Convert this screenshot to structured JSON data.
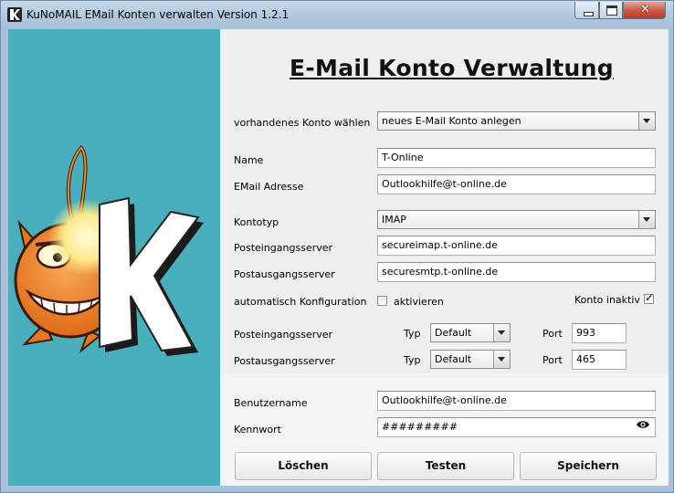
{
  "window": {
    "title": "KuNoMAIL EMail Konten verwalten Version 1.2.1"
  },
  "heading": "E-Mail Konto Verwaltung",
  "account_select": {
    "label": "vorhandenes Konto wählen",
    "value": "neues E-Mail Konto anlegen"
  },
  "name": {
    "label": "Name",
    "value": "T-Online"
  },
  "email": {
    "label": "EMail Adresse",
    "value": "Outlookhilfe@t-online.de"
  },
  "kontotyp": {
    "label": "Kontotyp",
    "value": "IMAP"
  },
  "incoming_server": {
    "label": "Posteingangsserver",
    "value": "secureimap.t-online.de"
  },
  "outgoing_server": {
    "label": "Postausgangsserver",
    "value": "securesmtp.t-online.de"
  },
  "auto_config": {
    "label": "automatisch Konfiguration",
    "checkbox_label": "aktivieren",
    "checked": false
  },
  "inactive": {
    "label": "Konto inaktiv",
    "checked": true
  },
  "incoming_settings": {
    "label": "Posteingangsserver",
    "type_label": "Typ",
    "type_value": "Default",
    "port_label": "Port",
    "port_value": "993"
  },
  "outgoing_settings": {
    "label": "Postausgangsserver",
    "type_label": "Typ",
    "type_value": "Default",
    "port_label": "Port",
    "port_value": "465"
  },
  "username": {
    "label": "Benutzername",
    "value": "Outlookhilfe@t-online.de"
  },
  "password": {
    "label": "Kennwort",
    "value": "#########"
  },
  "buttons": {
    "delete": "Löschen",
    "test": "Testen",
    "save": "Speichern"
  },
  "colors": {
    "sidebar": "#4aafbc",
    "panel": "#efefef",
    "mascot": "#f08a2a"
  },
  "icons": {
    "app": "kunomail-k-icon",
    "eye": "eye-icon",
    "mascot": "anglerfish-mascot-logo"
  }
}
